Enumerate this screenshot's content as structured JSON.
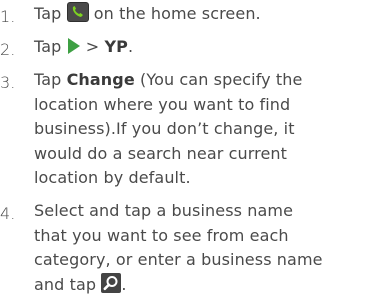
{
  "steps": [
    {
      "number": "1.",
      "parts": {
        "a": "Tap ",
        "b": " on the home screen."
      },
      "icon": "phone-app-icon"
    },
    {
      "number": "2.",
      "parts": {
        "a": "Tap ",
        "b": " > ",
        "yp": "YP",
        "c": "."
      },
      "icon": "green-arrow-icon"
    },
    {
      "number": "3.",
      "parts": {
        "a": "Tap ",
        "change": "Change",
        "b": " (You can specify the",
        "l2": "location where you want to find",
        "l3": "business).If you don’t change, it",
        "l4": "would do a search near current",
        "l5": "location by default."
      }
    },
    {
      "number": "4.",
      "parts": {
        "l1": "Select and tap a business name",
        "l2": "that you want to see from each",
        "l3": "category, or enter a business name",
        "l4a": "and tap ",
        "l4b": "."
      },
      "icon": "search-icon"
    }
  ],
  "colors": {
    "text": "#4a4a4a",
    "bold": "#3a3a3a",
    "phone_green": "#4caf50",
    "arrow_green": "#3ea043",
    "search_bg": "#444444"
  }
}
